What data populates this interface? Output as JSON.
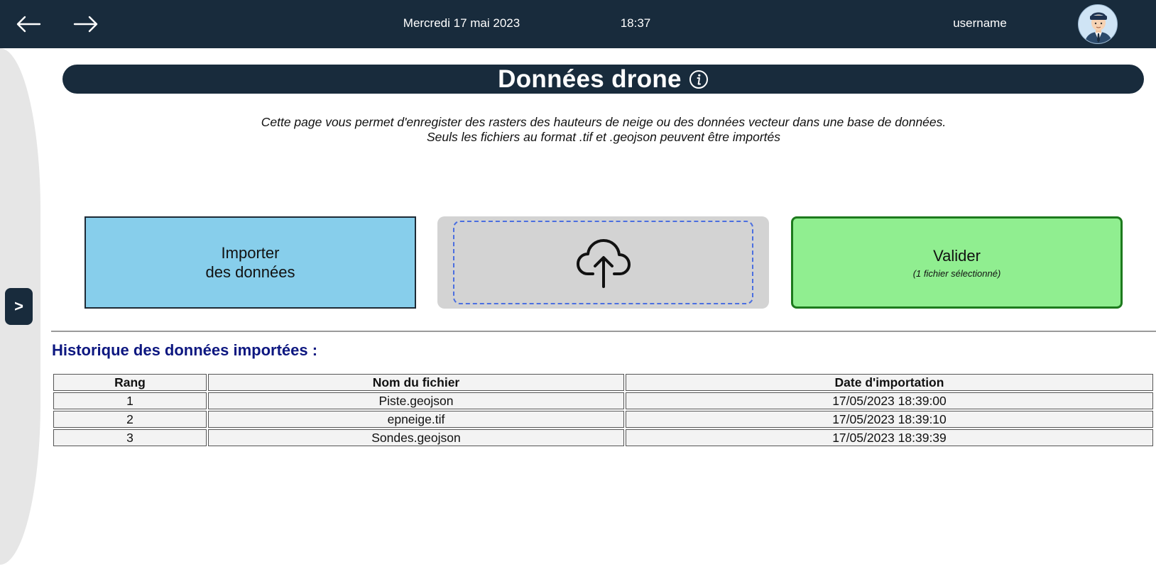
{
  "header": {
    "back_icon": "arrow-left-icon",
    "forward_icon": "arrow-right-icon",
    "date": "Mercredi 17 mai 2023",
    "time": "18:37",
    "username": "username",
    "avatar_icon": "user-avatar-icon"
  },
  "sidebar": {
    "toggle_label": ">"
  },
  "page": {
    "title": "Données drone",
    "info_icon": "info-icon",
    "description_line1": "Cette page vous permet d'enregister des rasters des hauteurs de neige ou des données vecteur dans une base de données.",
    "description_line2": "Seuls les fichiers au format .tif et .geojson peuvent être importés"
  },
  "actions": {
    "import_line1": "Importer",
    "import_line2": "des données",
    "upload_icon": "cloud-upload-icon",
    "validate_label": "Valider",
    "validate_sub": "(1 fichier sélectionné)"
  },
  "history": {
    "title": "Historique des données importées :",
    "columns": [
      "Rang",
      "Nom du fichier",
      "Date d'importation"
    ],
    "rows": [
      [
        "1",
        "Piste.geojson",
        "17/05/2023 18:39:00"
      ],
      [
        "2",
        "epneige.tif",
        "17/05/2023 18:39:10"
      ],
      [
        "3",
        "Sondes.geojson",
        "17/05/2023 18:39:39"
      ]
    ]
  },
  "colors": {
    "header_bg": "#182b3c",
    "import_bg": "#87ceeb",
    "validate_bg": "#90ee90",
    "dropzone_bg": "#d3d3d3",
    "history_title": "#0d1780"
  }
}
